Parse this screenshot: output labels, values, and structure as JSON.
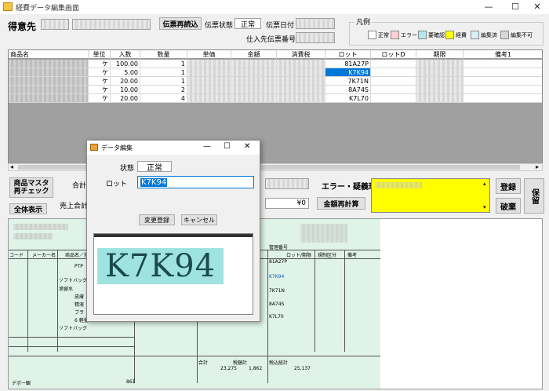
{
  "window": {
    "title": "経費データ編集画面",
    "min": "—",
    "max": "☐",
    "close": "✕"
  },
  "header": {
    "tokuisaki_label": "得意先",
    "reload_button": "伝票再読込",
    "status_label": "伝票状態",
    "status_value": "正常",
    "date_label": "伝票日付",
    "supplier_no_label": "仕入先伝票番号"
  },
  "legend": {
    "title": "凡例",
    "items": [
      {
        "label": "正常",
        "color": "#ffffff"
      },
      {
        "label": "エラー",
        "color": "#ffd0d6"
      },
      {
        "label": "要確認",
        "color": "#b0e8f0"
      },
      {
        "label": "経費",
        "color": "#ffff00"
      },
      {
        "label": "編集済",
        "color": "#d8f0f8"
      },
      {
        "label": "編集不可",
        "color": "#d8d8d8"
      }
    ]
  },
  "grid": {
    "columns": [
      "商品名",
      "単位",
      "入数",
      "数量",
      "単価",
      "金額",
      "消費税",
      "ロット",
      "ロットD",
      "期限",
      "備考1"
    ],
    "rows": [
      {
        "unit": "ケ",
        "irisu": "100.00",
        "qty": "1",
        "lot": "81A27P",
        "selected": false
      },
      {
        "unit": "ケ",
        "irisu": "5.00",
        "qty": "1",
        "lot": "K7K94",
        "selected": true
      },
      {
        "unit": "ケ",
        "irisu": "20.00",
        "qty": "1",
        "lot": "7K71N",
        "selected": false
      },
      {
        "unit": "ケ",
        "irisu": "10.00",
        "qty": "2",
        "lot": "8A74S",
        "selected": false
      },
      {
        "unit": "ケ",
        "irisu": "20.00",
        "qty": "4",
        "lot": "K7L70",
        "selected": false
      }
    ]
  },
  "left_buttons": {
    "master_check": "商品マスタ\n再チェック",
    "show_all": "全体表示"
  },
  "totals": {
    "total_label": "合計",
    "sales_total_label": "売上合計",
    "yen_value": "¥0",
    "recalc_button": "金額再計算"
  },
  "error": {
    "label": "エラー・疑義理由"
  },
  "right_buttons": {
    "register": "登録",
    "discard": "破棄",
    "save": "保留"
  },
  "dialog": {
    "title": "データ編集",
    "status_label": "状態",
    "status_value": "正常",
    "lot_label": "ロット",
    "lot_value": "K7K94",
    "apply_button": "変更登録",
    "cancel_button": "キャンセル",
    "preview_text": "K7K94"
  },
  "scan": {
    "col_headers": [
      "コード",
      "メーカー名",
      "商品名／規格",
      "ロット/期限",
      "規制区分",
      "備考"
    ],
    "items": [
      "PTP",
      "ソフトバッグ",
      "滴留水",
      "皮膚",
      "精液",
      "ブラ",
      "6 軽量",
      "ソフトバッグ"
    ],
    "lots": [
      "81A27P",
      "K7K94",
      "7K71N",
      "8A74S",
      "K7L70"
    ],
    "totals": {
      "sum_label": "合計",
      "sum": "23,275",
      "tax_label": "税額計",
      "tax": "1,862",
      "incl_label": "税込総計",
      "incl": "25,137"
    },
    "footer_left": "デポー観",
    "footer_code": "861",
    "mgmt_label": "管理番号"
  }
}
